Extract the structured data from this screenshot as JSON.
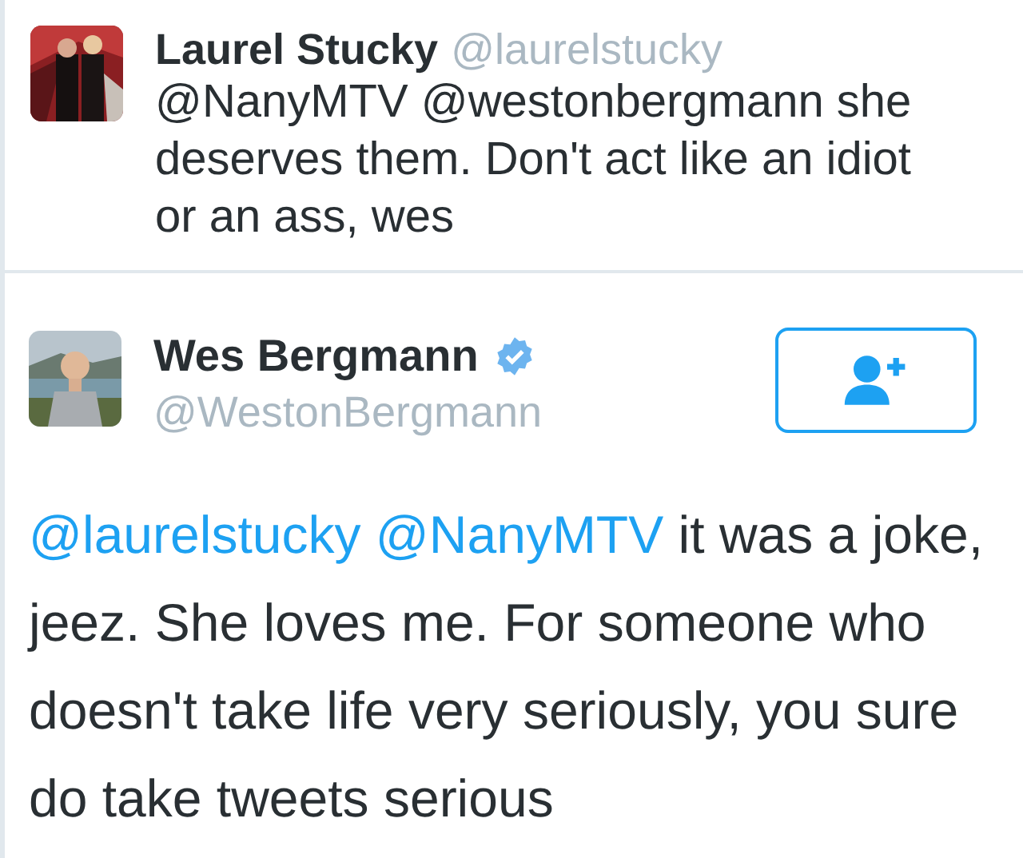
{
  "reply_tweet": {
    "name": "Laurel Stucky",
    "handle": "@laurelstucky",
    "text": "@NanyMTV @westonbergmann she deserves them. Don't act like an idiot or an ass, wes"
  },
  "main_tweet": {
    "name": "Wes Bergmann",
    "verified": true,
    "handle": "@WestonBergmann",
    "follow_button": {
      "kind": "follow"
    },
    "text": [
      {
        "kind": "mention",
        "text": "@laurelstucky"
      },
      {
        "kind": "mention",
        "text": "@NanyMTV"
      },
      {
        "kind": "plain",
        "text": "it was a joke, jeez. She loves me. For someone who doesn't take life very seriously, you sure do take tweets serious"
      }
    ]
  }
}
